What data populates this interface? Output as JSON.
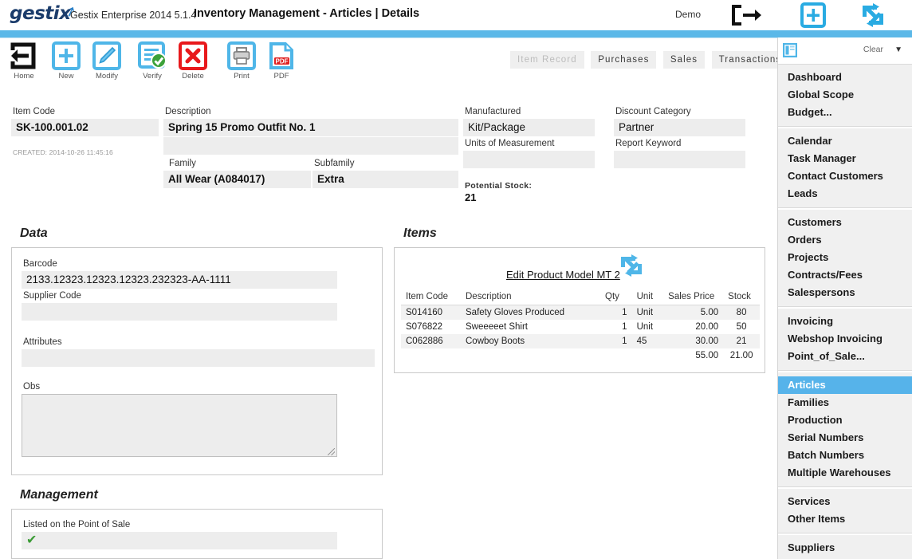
{
  "header": {
    "logo_text": "gestix",
    "app_version": "Gestix Enterprise 2014 5.1.4",
    "page_title": "Inventory Management - Articles | Details",
    "demo_label": "Demo",
    "icons": {
      "logout": "logout-icon",
      "add": "add-new-icon",
      "sync": "refresh-sync-icon"
    }
  },
  "toolbar": [
    {
      "label": "Home",
      "icon": "home-exit-icon"
    },
    {
      "label": "New",
      "icon": "plus-new-icon"
    },
    {
      "label": "Modify",
      "icon": "pencil-edit-icon"
    },
    {
      "label": "Verify",
      "icon": "checklist-verify-icon"
    },
    {
      "label": "Delete",
      "icon": "red-x-delete-icon"
    },
    {
      "label": "Print",
      "icon": "printer-icon"
    },
    {
      "label": "PDF",
      "icon": "pdf-file-icon"
    }
  ],
  "tabs": [
    {
      "label": "Item Record",
      "disabled": true
    },
    {
      "label": "Purchases",
      "disabled": false
    },
    {
      "label": "Sales",
      "disabled": false
    },
    {
      "label": "Transactions",
      "disabled": false
    }
  ],
  "form": {
    "item_code_label": "Item Code",
    "item_code_value": "SK-100.001.02",
    "created_text": "CREATED: 2014-10-26 11:45:16",
    "description_label": "Description",
    "description_value": "Spring 15 Promo Outfit No. 1",
    "description_value2": "",
    "family_label": "Family",
    "family_value": "All Wear (A084017)",
    "subfamily_label": "Subfamily",
    "subfamily_value": "Extra",
    "manufactured_label": "Manufactured",
    "manufactured_value": "Kit/Package",
    "units_label": "Units of Measurement",
    "units_value": "",
    "discount_label": "Discount Category",
    "discount_value": "Partner",
    "report_keyword_label": "Report Keyword",
    "report_keyword_value": "",
    "potential_stock_label": "Potential Stock:",
    "potential_stock_value": "21"
  },
  "data_section": {
    "title": "Data",
    "barcode_label": "Barcode",
    "barcode_value": "2133.12323.12323.12323.232323-AA-1111",
    "supplier_code_label": "Supplier Code",
    "supplier_code_value": "",
    "attributes_label": "Attributes",
    "attributes_value": "",
    "obs_label": "Obs",
    "obs_value": ""
  },
  "items_section": {
    "title": "Items",
    "edit_link": "Edit Product Model MT 2",
    "edit_icon": "refresh-sync-icon",
    "columns": [
      "Item Code",
      "Description",
      "Qty",
      "Unit",
      "Sales Price",
      "Stock"
    ],
    "rows": [
      {
        "item_code": "S014160",
        "description": "Safety Gloves Produced",
        "qty": "1",
        "unit": "Unit",
        "sales_price": "5.00",
        "stock": "80"
      },
      {
        "item_code": "S076822",
        "description": "Sweeeeet Shirt",
        "qty": "1",
        "unit": "Unit",
        "sales_price": "20.00",
        "stock": "50"
      },
      {
        "item_code": "C062886",
        "description": "Cowboy Boots",
        "qty": "1",
        "unit": "45",
        "sales_price": "30.00",
        "stock": "21"
      }
    ],
    "totals": {
      "sales_price": "55.00",
      "stock": "21.00"
    }
  },
  "management_section": {
    "title": "Management",
    "pos_label": "Listed on the Point of Sale",
    "pos_checked": true
  },
  "sidebar": {
    "panel_icon": "side-panel-toggle-icon",
    "clear_label": "Clear",
    "caret_icon": "chevron-down-icon",
    "groups": [
      {
        "items": [
          {
            "label": "Dashboard",
            "active": false
          },
          {
            "label": "Global Scope",
            "active": false
          },
          {
            "label": "Budget...",
            "active": false
          }
        ]
      },
      {
        "items": [
          {
            "label": "Calendar",
            "active": false
          },
          {
            "label": "Task Manager",
            "active": false
          },
          {
            "label": "Contact Customers",
            "active": false
          },
          {
            "label": "Leads",
            "active": false
          }
        ]
      },
      {
        "items": [
          {
            "label": "Customers",
            "active": false
          },
          {
            "label": "Orders",
            "active": false
          },
          {
            "label": "Projects",
            "active": false
          },
          {
            "label": "Contracts/Fees",
            "active": false
          },
          {
            "label": "Salespersons",
            "active": false
          }
        ]
      },
      {
        "items": [
          {
            "label": "Invoicing",
            "active": false
          },
          {
            "label": "Webshop Invoicing",
            "active": false
          },
          {
            "label": "Point_of_Sale...",
            "active": false
          }
        ]
      },
      {
        "items": [
          {
            "label": "Articles",
            "active": true
          },
          {
            "label": "Families",
            "active": false
          },
          {
            "label": "Production",
            "active": false
          },
          {
            "label": "Serial Numbers",
            "active": false
          },
          {
            "label": "Batch Numbers",
            "active": false
          },
          {
            "label": "Multiple Warehouses",
            "active": false
          }
        ]
      },
      {
        "items": [
          {
            "label": "Services",
            "active": false
          },
          {
            "label": "Other Items",
            "active": false
          }
        ]
      },
      {
        "items": [
          {
            "label": "Suppliers",
            "active": false
          }
        ]
      }
    ]
  },
  "colors": {
    "brand_blue": "#5bb8e8",
    "accent_blue": "#56b3ea",
    "logo_navy": "#1b3c6b",
    "delete_red": "#e8191c",
    "verify_green": "#3a9b35",
    "field_bg": "#ededed"
  }
}
